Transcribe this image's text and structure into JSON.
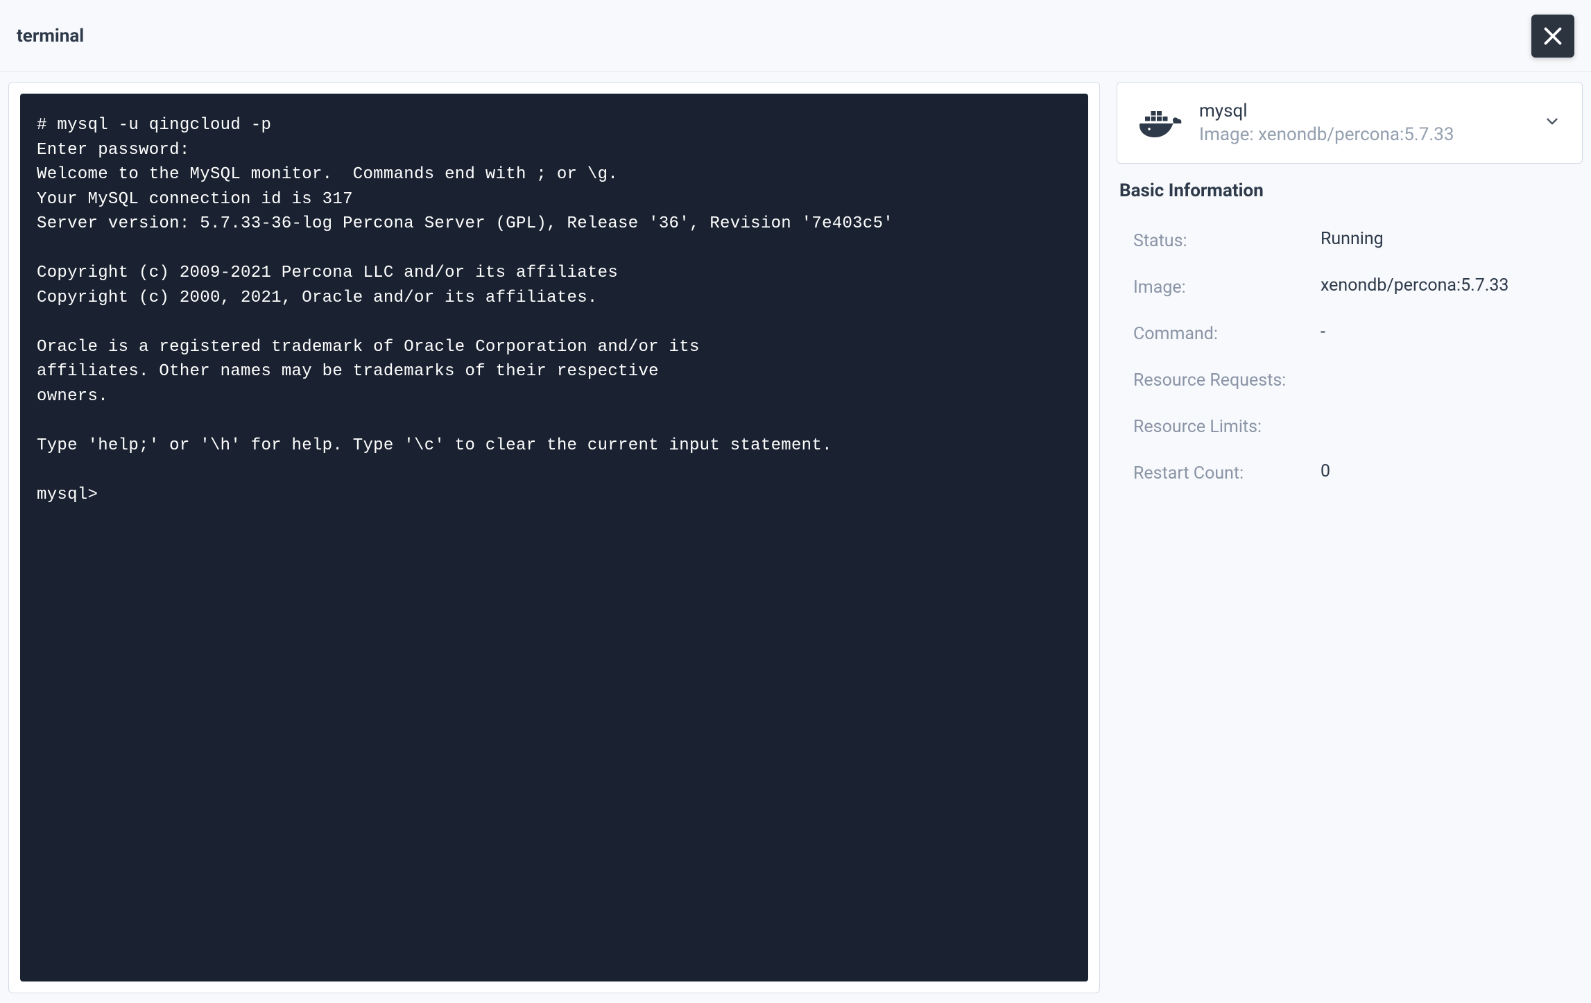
{
  "header": {
    "title": "terminal"
  },
  "terminal": {
    "output": "# mysql -u qingcloud -p\nEnter password:\nWelcome to the MySQL monitor.  Commands end with ; or \\g.\nYour MySQL connection id is 317\nServer version: 5.7.33-36-log Percona Server (GPL), Release '36', Revision '7e403c5'\n\nCopyright (c) 2009-2021 Percona LLC and/or its affiliates\nCopyright (c) 2000, 2021, Oracle and/or its affiliates.\n\nOracle is a registered trademark of Oracle Corporation and/or its\naffiliates. Other names may be trademarks of their respective\nowners.\n\nType 'help;' or '\\h' for help. Type '\\c' to clear the current input statement.\n\nmysql>"
  },
  "container": {
    "name": "mysql",
    "image_label": "Image: xenondb/percona:5.7.33"
  },
  "basic_info": {
    "title": "Basic Information",
    "rows": [
      {
        "label": "Status:",
        "value": "Running"
      },
      {
        "label": "Image:",
        "value": "xenondb/percona:5.7.33"
      },
      {
        "label": "Command:",
        "value": "-"
      },
      {
        "label": "Resource Requests:",
        "value": ""
      },
      {
        "label": "Resource Limits:",
        "value": ""
      },
      {
        "label": "Restart Count:",
        "value": "0"
      }
    ]
  }
}
